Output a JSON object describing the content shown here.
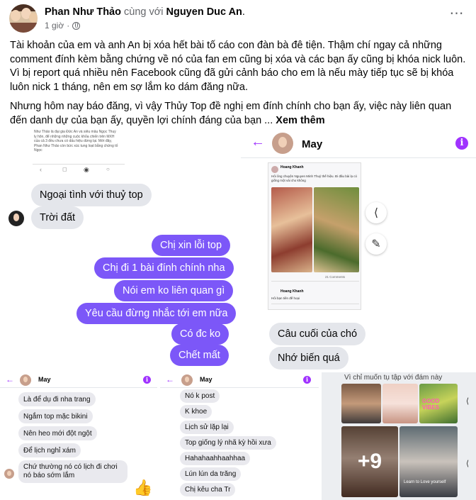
{
  "post": {
    "author": "Phan Như Thảo",
    "with_text": "cùng với",
    "tagged": "Nguyen Duc An",
    "tagged_suffix": ".",
    "time": "1 giờ",
    "time_sep": "·",
    "paragraph1": "Tài khoản của em và anh An bị xóa hết bài tố cáo con đàn bà đê tiện. Thậm chí ngay cả những comment đính kèm bằng chứng về nó của fan em cũng bị xóa và các bạn ấy cũng bị khóa nick luôn. Vì bị report quá nhiều nên Facebook cũng đã gửi cảnh báo cho em là nếu mày tiếp tục sẽ bị khóa luôn nick 1 tháng, nên em sợ lắm ko dám đăng nữa.",
    "paragraph2": "Nhưng hôm nay báo đăng, vì vậy Thủy Top đề nghị em đính chính cho bạn ấy, việc này liên quan đến danh dự của bạn ấy, quyền lợi chính đáng của bạn ...",
    "see_more": "Xem thêm",
    "more_icon": "⋯"
  },
  "img1": {
    "article_text": "Như Thảo là đại gia Đức An và siêu mẫu Ngọc Thuỷ ly hôn, để những những cuộc khỏa chiến trên MXH của cả 3 đều chưa có dấu hiệu dừng lại. Mới đây, Phan Như Thảo còn bức xúc tung loạt bằng chứng tố Ngọc",
    "messages": [
      {
        "text": "Ngoại tình với thuỷ top",
        "dir": "in"
      },
      {
        "text": "Trời đất",
        "dir": "in"
      },
      {
        "text": "Chị xin lỗi top",
        "dir": "out"
      },
      {
        "text": "Chị đi 1 bài đính chính nha",
        "dir": "out"
      },
      {
        "text": "Nói em ko liên quan gì",
        "dir": "out"
      },
      {
        "text": "Yêu cầu đừng nhắc tới em nữa",
        "dir": "out"
      },
      {
        "text": "Có đc ko",
        "dir": "out"
      },
      {
        "text": "Chết mất",
        "dir": "out"
      }
    ]
  },
  "img2": {
    "contact": "May",
    "shared_author": "Hoang Khanh",
    "shared_text": "Hôi ông chuyện Nguyen Minh Thuỷ thế hiệu. Đi đâu bài lạ có giống một vài cho không",
    "shared_author2": "Hoang Khanh",
    "shared_text2": "Hôi bạn tiên đế hoại",
    "comments_label": "21 Comments",
    "messages": [
      {
        "text": "Câu cuối của chó"
      },
      {
        "text": "Nhớ biến quá"
      }
    ]
  },
  "img3": {
    "contact": "May",
    "messages": [
      {
        "text": "Là để dụ đi nha trang"
      },
      {
        "text": "Ngắm top mặc bikini"
      },
      {
        "text": "Nên heo mới đột ngột"
      },
      {
        "text": "Để lịch nghỉ xám"
      },
      {
        "text": "Chứ thường nó có lịch đi chơi nó báo sớm lắm"
      }
    ]
  },
  "img4": {
    "contact": "May",
    "messages": [
      {
        "text": "Nó k post"
      },
      {
        "text": "K khoe"
      },
      {
        "text": "Lịch sử lặp lại"
      },
      {
        "text": "Top giống lý nhã kỳ hồi xưa"
      },
      {
        "text": "Hahahaahhaahhaa"
      },
      {
        "text": "Lún lún da trăng"
      },
      {
        "text": "Chị kêu cha Tr"
      }
    ]
  },
  "img5": {
    "caption": "Vì chỉ muốn tụ tập với đám này",
    "overlay": "+9",
    "sticker_text": "GOOD VIBES",
    "photo_text": "Learn to Love yourself"
  },
  "colors": {
    "messenger_purple": "#7c57f8",
    "accent": "#a033ff",
    "incoming_bubble": "#e4e6eb",
    "secondary_text": "#65676b"
  }
}
